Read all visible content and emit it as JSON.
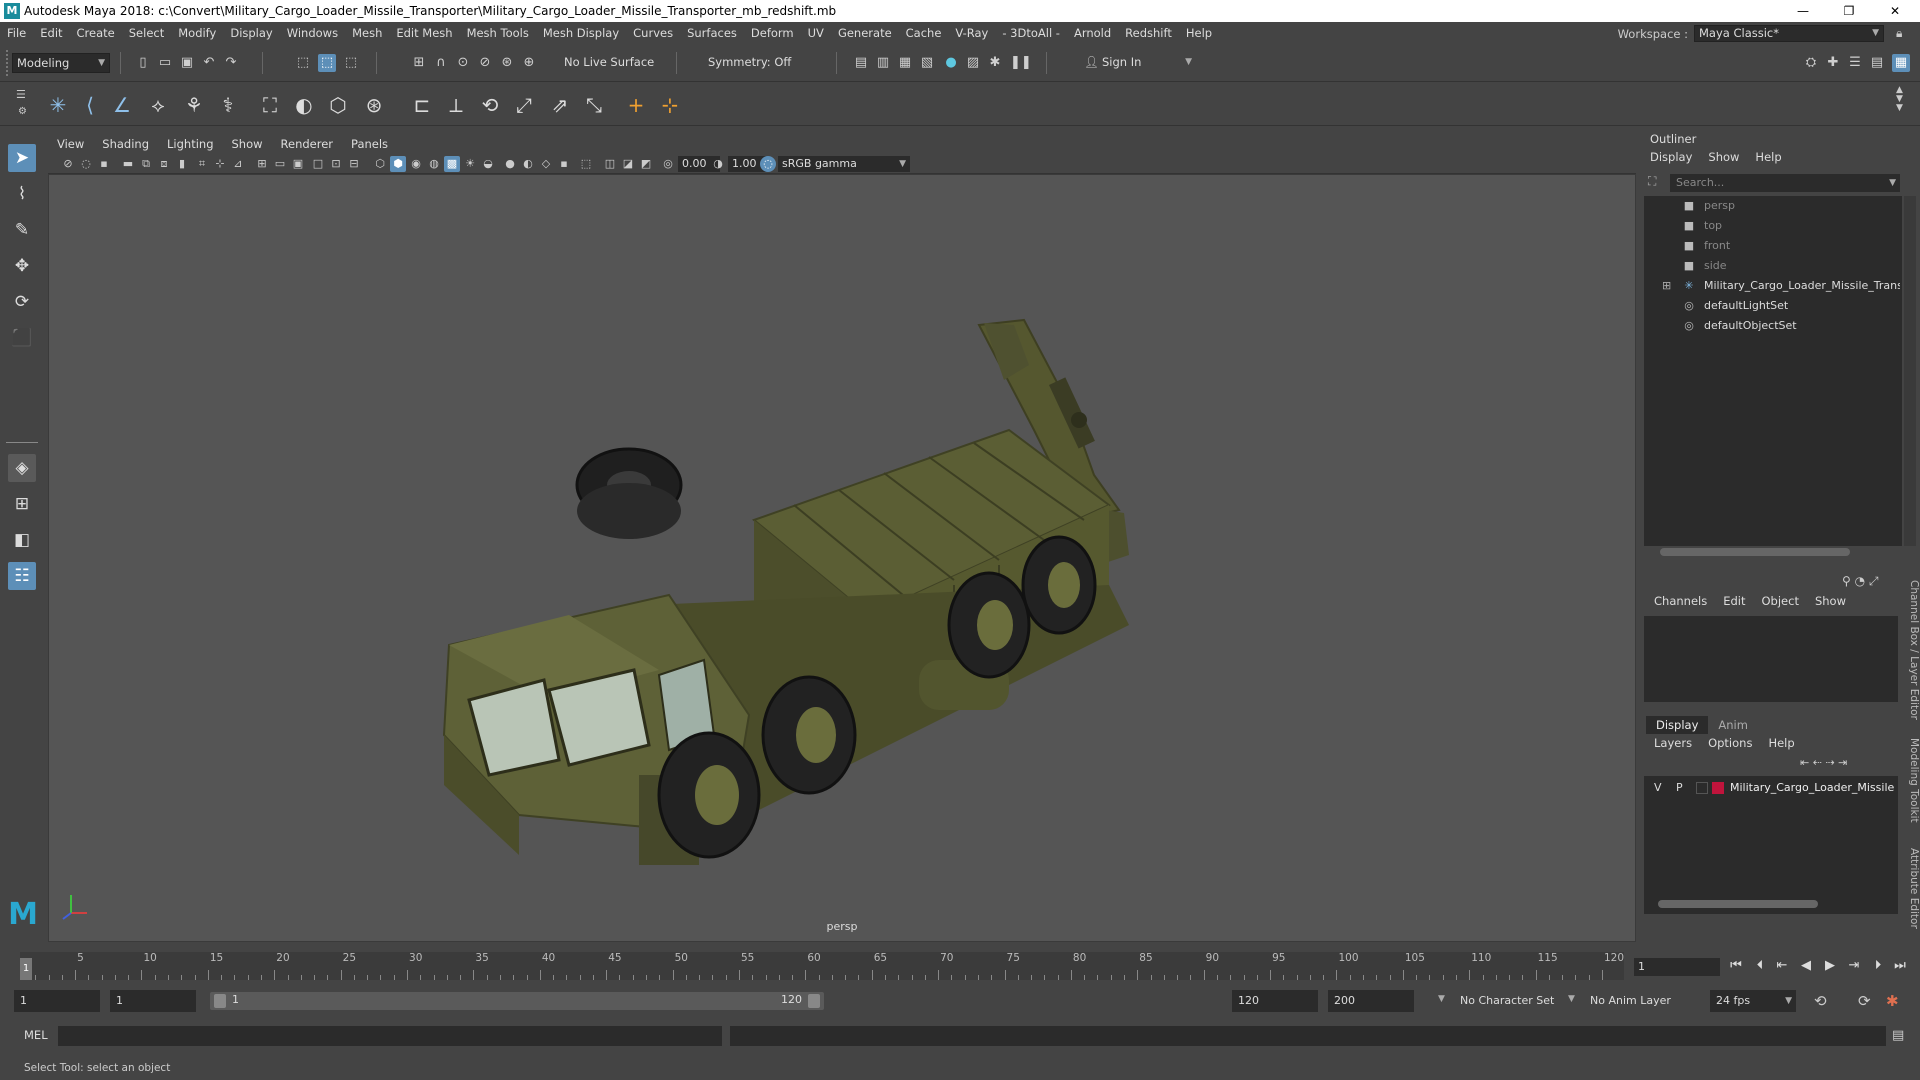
{
  "window": {
    "title": "Autodesk Maya 2018: c:\\Convert\\Military_Cargo_Loader_Missile_Transporter\\Military_Cargo_Loader_Missile_Transporter_mb_redshift.mb",
    "logo_letter": "M",
    "controls": {
      "minimize": "—",
      "maximize": "❐",
      "close": "✕"
    }
  },
  "menubar": {
    "items": [
      "File",
      "Edit",
      "Create",
      "Select",
      "Modify",
      "Display",
      "Windows",
      "Mesh",
      "Edit Mesh",
      "Mesh Tools",
      "Mesh Display",
      "Curves",
      "Surfaces",
      "Deform",
      "UV",
      "Generate",
      "Cache",
      "V-Ray",
      "- 3DtoAll -",
      "Arnold",
      "Redshift",
      "Help"
    ],
    "workspace_label": "Workspace :",
    "workspace_value": "Maya Classic*"
  },
  "statusline": {
    "mode": "Modeling",
    "live_surface": "No Live Surface",
    "symmetry": "Symmetry: Off",
    "sign_in": "Sign In"
  },
  "viewport": {
    "menu": [
      "View",
      "Shading",
      "Lighting",
      "Show",
      "Renderer",
      "Panels"
    ],
    "exposure": "0.00",
    "gamma": "1.00",
    "color_space": "sRGB gamma",
    "camera_label": "persp"
  },
  "outliner": {
    "title": "Outliner",
    "menu": [
      "Display",
      "Show",
      "Help"
    ],
    "search_placeholder": "Search...",
    "items": [
      {
        "label": "persp",
        "type": "camera"
      },
      {
        "label": "top",
        "type": "camera"
      },
      {
        "label": "front",
        "type": "camera"
      },
      {
        "label": "side",
        "type": "camera"
      },
      {
        "label": "Military_Cargo_Loader_Missile_Transport",
        "type": "group"
      },
      {
        "label": "defaultLightSet",
        "type": "set"
      },
      {
        "label": "defaultObjectSet",
        "type": "set"
      }
    ]
  },
  "channelbox": {
    "menu": [
      "Channels",
      "Edit",
      "Object",
      "Show"
    ],
    "tabs": [
      "Display",
      "Anim"
    ],
    "layer_menu": [
      "Layers",
      "Options",
      "Help"
    ],
    "layer": {
      "v": "V",
      "p": "P",
      "name": "Military_Cargo_Loader_Missile",
      "color": "#c0143c"
    }
  },
  "side_tabs": [
    "Channel Box / Layer Editor",
    "Modeling Toolkit",
    "Attribute Editor"
  ],
  "timeline": {
    "ticks": [
      1,
      5,
      10,
      15,
      20,
      25,
      30,
      35,
      40,
      45,
      50,
      55,
      60,
      65,
      70,
      75,
      80,
      85,
      90,
      95,
      100,
      105,
      110,
      115,
      120
    ],
    "current_frame": "1",
    "current_frame_box": "1"
  },
  "range": {
    "start": "1",
    "playback_start": "1",
    "slider_start": "1",
    "slider_end": "120",
    "playback_end": "120",
    "end": "200",
    "character_set": "No Character Set",
    "anim_layer": "No Anim Layer",
    "fps": "24 fps"
  },
  "cmdline": {
    "label": "MEL"
  },
  "helpline": {
    "text": "Select Tool: select an object"
  }
}
